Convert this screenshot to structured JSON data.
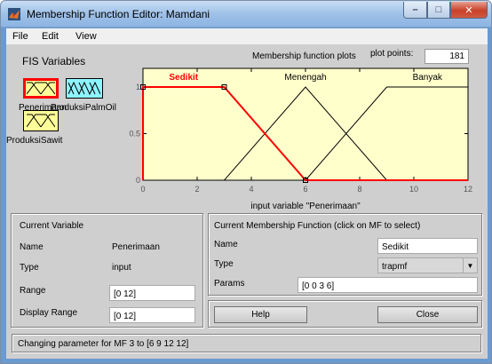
{
  "window": {
    "title": "Membership Function Editor: Mamdani",
    "min_icon": "minimize-icon",
    "max_icon": "maximize-icon",
    "close_icon": "close-icon",
    "close_glyph": "✕",
    "min_glyph": "–",
    "max_glyph": "□"
  },
  "menu": {
    "items": [
      "File",
      "Edit",
      "View"
    ]
  },
  "fis": {
    "label": "FIS Variables",
    "variables": [
      {
        "name": "Penerimaan",
        "kind": "input",
        "selected": true
      },
      {
        "name": "ProduksiPalmOil",
        "kind": "output",
        "selected": false
      },
      {
        "name": "ProduksiSawit",
        "kind": "input",
        "selected": false
      }
    ]
  },
  "plot": {
    "title": "Membership function plots",
    "plot_points_label": "plot points:",
    "plot_points_value": "181",
    "mf_labels": [
      "Sedikit",
      "Menengah",
      "Banyak"
    ],
    "x_ticks": [
      "0",
      "2",
      "4",
      "6",
      "8",
      "10",
      "12"
    ],
    "y_ticks": [
      "0",
      "0.5",
      "1"
    ],
    "xlabel": "input variable \"Penerimaan\"",
    "colors": {
      "background": "#ffffcc",
      "selected_mf": "#ff0000",
      "mf": "#000000"
    }
  },
  "chart_data": {
    "type": "line",
    "xlabel": "input variable \"Penerimaan\"",
    "ylabel": "",
    "xlim": [
      0,
      12
    ],
    "ylim": [
      0,
      1
    ],
    "series": [
      {
        "name": "Sedikit",
        "mf_type": "trapmf",
        "x": [
          0,
          0,
          3,
          6,
          12
        ],
        "y": [
          0,
          1,
          1,
          0,
          0
        ],
        "selected": true
      },
      {
        "name": "Menengah",
        "mf_type": "trimf",
        "x": [
          0,
          3,
          6,
          9,
          12
        ],
        "y": [
          0,
          0,
          1,
          0,
          0
        ],
        "selected": false
      },
      {
        "name": "Banyak",
        "mf_type": "trapmf",
        "x": [
          0,
          6,
          9,
          12
        ],
        "y": [
          0,
          0,
          1,
          1
        ],
        "selected": false
      }
    ]
  },
  "current_variable": {
    "header": "Current Variable",
    "name_label": "Name",
    "name_value": "Penerimaan",
    "type_label": "Type",
    "type_value": "input",
    "range_label": "Range",
    "range_value": "[0 12]",
    "display_range_label": "Display Range",
    "display_range_value": "[0 12]"
  },
  "current_mf": {
    "header": "Current Membership Function (click on MF to select)",
    "name_label": "Name",
    "name_value": "Sedikit",
    "type_label": "Type",
    "type_value": "trapmf",
    "params_label": "Params",
    "params_value": "[0 0 3 6]"
  },
  "buttons": {
    "help": "Help",
    "close": "Close"
  },
  "status": "Changing parameter for MF 3 to  [6 9 12 12]"
}
